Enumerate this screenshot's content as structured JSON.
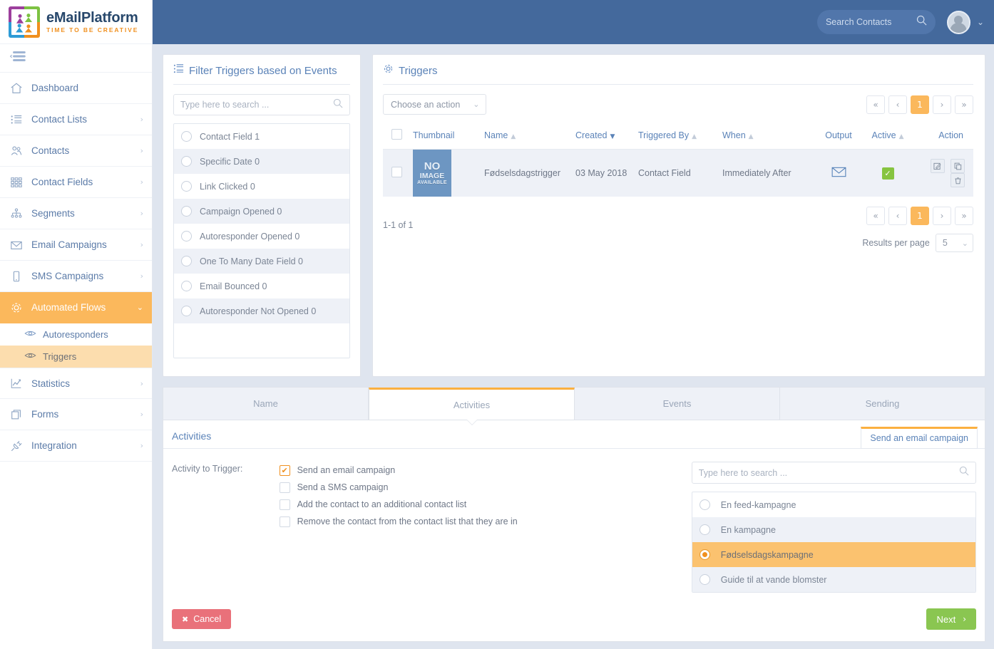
{
  "brand": {
    "title": "eMailPlatform",
    "tagline": "TIME TO BE CREATIVE"
  },
  "topbar": {
    "search_placeholder": "Search Contacts",
    "search_icon": "search-icon",
    "avatar_caret": "⌄"
  },
  "sidebar": {
    "collapse_icon": "collapse-menu-icon",
    "items": [
      {
        "label": "Dashboard",
        "icon": "home-icon",
        "chevron": "",
        "active": false
      },
      {
        "label": "Contact Lists",
        "icon": "list-icon",
        "chevron": "›",
        "active": false
      },
      {
        "label": "Contacts",
        "icon": "users-icon",
        "chevron": "›",
        "active": false
      },
      {
        "label": "Contact Fields",
        "icon": "grid-icon",
        "chevron": "›",
        "active": false
      },
      {
        "label": "Segments",
        "icon": "sitemap-icon",
        "chevron": "›",
        "active": false
      },
      {
        "label": "Email Campaigns",
        "icon": "envelope-icon",
        "chevron": "›",
        "active": false
      },
      {
        "label": "SMS Campaigns",
        "icon": "mobile-icon",
        "chevron": "›",
        "active": false
      },
      {
        "label": "Automated Flows",
        "icon": "gear-icon",
        "chevron": "⌄",
        "active": true
      }
    ],
    "subitems": [
      {
        "label": "Autoresponders",
        "icon": "eye-icon",
        "selected": false
      },
      {
        "label": "Triggers",
        "icon": "eye-icon",
        "selected": true
      }
    ],
    "items_after": [
      {
        "label": "Statistics",
        "icon": "chart-line-icon",
        "chevron": "›",
        "active": false
      },
      {
        "label": "Forms",
        "icon": "forms-icon",
        "chevron": "›",
        "active": false
      },
      {
        "label": "Integration",
        "icon": "plug-icon",
        "chevron": "›",
        "active": false
      }
    ]
  },
  "filter_panel": {
    "title": "Filter Triggers based on Events",
    "title_icon": "list-filter-icon",
    "search_placeholder": "Type here to search ...",
    "search_icon": "search-icon",
    "options": [
      {
        "label": "Contact Field 1"
      },
      {
        "label": "Specific Date 0"
      },
      {
        "label": "Link Clicked 0"
      },
      {
        "label": "Campaign Opened 0"
      },
      {
        "label": "Autoresponder Opened 0"
      },
      {
        "label": "One To Many Date Field 0"
      },
      {
        "label": "Email Bounced 0"
      },
      {
        "label": "Autoresponder Not Opened 0"
      }
    ]
  },
  "triggers_panel": {
    "title": "Triggers",
    "title_icon": "gear-icon",
    "action_select": {
      "value": "Choose an action",
      "caret": "⌄"
    },
    "pager_top": [
      {
        "label": "«",
        "name": "first"
      },
      {
        "label": "‹",
        "name": "prev"
      },
      {
        "label": "1",
        "name": "page-1",
        "current": true
      },
      {
        "label": "›",
        "name": "next"
      },
      {
        "label": "»",
        "name": "last"
      }
    ],
    "pager_bottom": [
      {
        "label": "«",
        "name": "first"
      },
      {
        "label": "‹",
        "name": "prev"
      },
      {
        "label": "1",
        "name": "page-1",
        "current": true
      },
      {
        "label": "›",
        "name": "next"
      },
      {
        "label": "»",
        "name": "last"
      }
    ],
    "columns": [
      {
        "label": "Thumbnail",
        "sortable": false
      },
      {
        "label": "Name",
        "sortable": true,
        "sort": "asc"
      },
      {
        "label": "Created",
        "sortable": true,
        "sort": "desc"
      },
      {
        "label": "Triggered By",
        "sortable": true
      },
      {
        "label": "When",
        "sortable": true
      },
      {
        "label": "Output",
        "sortable": false
      },
      {
        "label": "Active",
        "sortable": true
      },
      {
        "label": "Action",
        "sortable": false
      }
    ],
    "rows": [
      {
        "thumbnail": {
          "line1": "NO",
          "line2": "IMAGE",
          "line3": "AVAILABLE"
        },
        "name": "Fødselsdagstrigger",
        "created": "03 May 2018",
        "triggered_by": "Contact Field",
        "when": "Immediately After",
        "output_icon": "envelope-icon",
        "active": true,
        "actions": [
          "edit-icon",
          "copy-icon",
          "trash-icon"
        ]
      }
    ],
    "result_count": "1-1 of 1",
    "results_per_page_label": "Results per page",
    "results_per_page_value": "5",
    "results_per_page_caret": "⌄"
  },
  "tabs": [
    {
      "label": "Name",
      "active": false
    },
    {
      "label": "Activities",
      "active": true
    },
    {
      "label": "Events",
      "active": false
    },
    {
      "label": "Sending",
      "active": false
    }
  ],
  "activities": {
    "section_title": "Activities",
    "section_chip": "Send an email campaign",
    "field_label": "Activity to Trigger:",
    "checkboxes": [
      {
        "label": "Send an email campaign",
        "checked": true,
        "mark": "✔"
      },
      {
        "label": "Send a SMS campaign",
        "checked": false,
        "mark": ""
      },
      {
        "label": "Add the contact to an additional contact list",
        "checked": false,
        "mark": ""
      },
      {
        "label": "Remove the contact from the contact list that they are in",
        "checked": false,
        "mark": ""
      }
    ],
    "campaign_search_placeholder": "Type here to search ...",
    "campaign_search_icon": "search-icon",
    "campaigns": [
      {
        "label": "En feed-kampagne",
        "selected": false
      },
      {
        "label": "En kampagne",
        "selected": false
      },
      {
        "label": "Fødselsdagskampagne",
        "selected": true
      },
      {
        "label": "Guide til at vande blomster",
        "selected": false
      }
    ],
    "cancel_label": "Cancel",
    "cancel_icon": "✖",
    "next_label": "Next",
    "next_icon": "›"
  },
  "colors": {
    "topbar": "#44699c",
    "accent_orange": "#fbb85c",
    "accent_orange_dark": "#f0901f",
    "link_blue": "#5b83b8",
    "green": "#8ac651",
    "red": "#e9717a",
    "page_bg": "#dfe5ef"
  }
}
